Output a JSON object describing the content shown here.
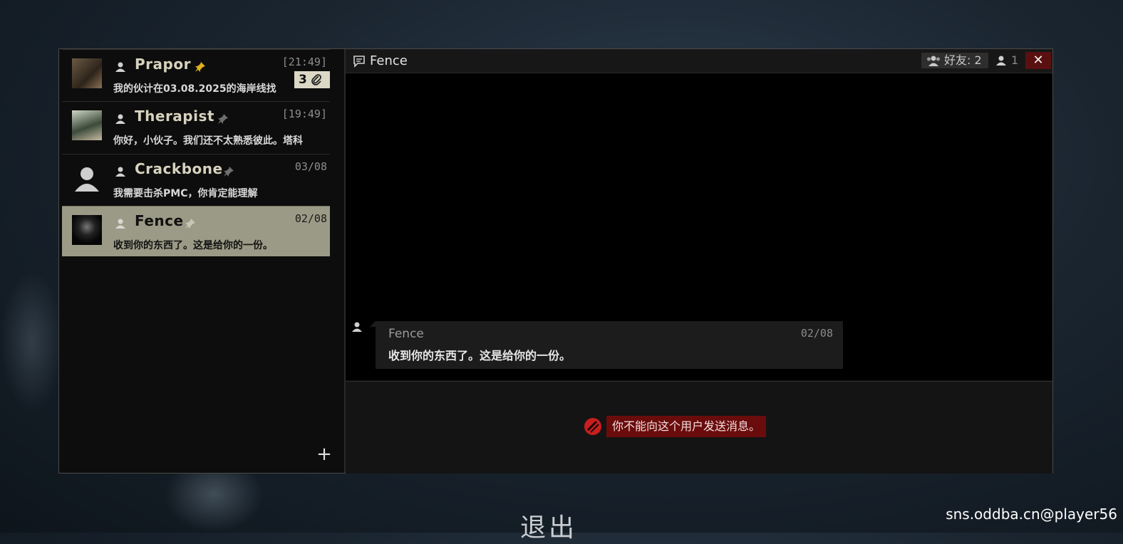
{
  "dialogs": [
    {
      "name": "Prapor",
      "time": "[21:49]",
      "preview": "我的伙计在03.08.2025的海岸线找",
      "pinned": true,
      "attachments": "3"
    },
    {
      "name": "Therapist",
      "time": "[19:49]",
      "preview": "你好，小伙子。我们还不太熟悉彼此。塔科",
      "pinned": false
    },
    {
      "name": "Crackbone",
      "time": "03/08",
      "preview": "我需要击杀PMC，你肯定能理解",
      "pinned": false
    },
    {
      "name": "Fence",
      "time": "02/08",
      "preview": "收到你的东西了。这是给你的一份。",
      "pinned": false,
      "selected": true
    }
  ],
  "add_label": "+",
  "chat": {
    "title": "Fence",
    "friends_label": "好友: 2",
    "members_count": "1",
    "close_label": "✕",
    "message": {
      "sender": "Fence",
      "time": "02/08",
      "text": "收到你的东西了。这是给你的一份。"
    },
    "blocked_notice": "你不能向这个用户发送消息。"
  },
  "exit_label": "退出",
  "watermark": "sns.oddba.cn@player56",
  "colors": {
    "selected_row": "#9b9a86",
    "close_bg": "#5a1010",
    "blocked_bg": "#6a0c0c",
    "pin_active": "#e0b020"
  }
}
